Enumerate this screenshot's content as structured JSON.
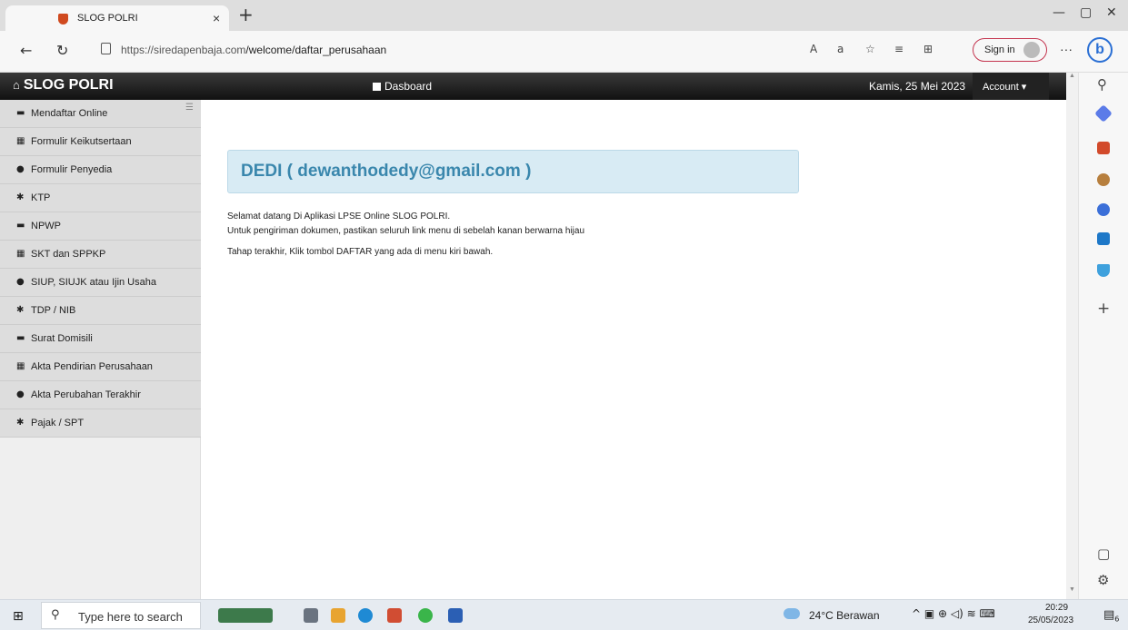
{
  "browser": {
    "tab_title": "SLOG POLRI",
    "tab_close": "×",
    "new_tab": "+",
    "url_host": "https://siredapenbaja.com",
    "url_path": "/welcome/daftar_perusahaan",
    "sign_in": "Sign in",
    "more": "···",
    "bing": "b",
    "window_controls": [
      "—",
      "▢",
      "✕"
    ]
  },
  "app": {
    "brand": "SLOG POLRI",
    "dashboard": "Dasboard",
    "date": "Kamis, 25 Mei 2023",
    "account": "Account ▾"
  },
  "sidebar": {
    "items": [
      {
        "icon": "inbox-icon",
        "label": "Mendaftar Online"
      },
      {
        "icon": "grid-icon",
        "label": "Formulir Keikutsertaan"
      },
      {
        "icon": "user-icon",
        "label": "Formulir Penyedia"
      },
      {
        "icon": "cog-icon",
        "label": "KTP"
      },
      {
        "icon": "inbox-icon",
        "label": "NPWP"
      },
      {
        "icon": "grid-icon",
        "label": "SKT dan SPPKP"
      },
      {
        "icon": "user-icon",
        "label": "SIUP, SIUJK atau Ijin Usaha"
      },
      {
        "icon": "cog-icon",
        "label": "TDP / NIB"
      },
      {
        "icon": "inbox-icon",
        "label": "Surat Domisili"
      },
      {
        "icon": "grid-icon",
        "label": "Akta Pendirian Perusahaan"
      },
      {
        "icon": "user-icon",
        "label": "Akta Perubahan Terakhir"
      },
      {
        "icon": "cog-icon",
        "label": "Pajak / SPT"
      }
    ]
  },
  "main": {
    "welcome": "DEDI    ( dewanthodedy@gmail.com )",
    "line1": "Selamat datang Di Aplikasi LPSE Online SLOG POLRI.",
    "line2": "Untuk pengiriman dokumen, pastikan seluruh link menu di sebelah kanan berwarna hijau",
    "line3": "Tahap terakhir, Klik tombol DAFTAR yang ada di menu kiri bawah."
  },
  "taskbar": {
    "search_placeholder": "Type here to search",
    "weather": "24°C  Berawan",
    "time": "20:29",
    "date": "25/05/2023",
    "notifications": "6"
  },
  "colors": {
    "welcome_text": "#3a87ad",
    "welcome_bg": "#d8ebf4",
    "navbar": "#1a1a1a"
  }
}
